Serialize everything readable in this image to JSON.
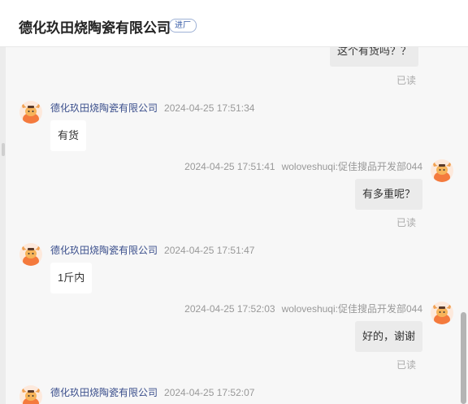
{
  "header": {
    "title": "德化玖田烧陶瓷有限公司",
    "tag": "进厂"
  },
  "read_label": "已读",
  "messages": [
    {
      "side": "out",
      "text": "这个有货吗？？",
      "read": "已读"
    },
    {
      "side": "in",
      "sender": "德化玖田烧陶瓷有限公司",
      "time": "2024-04-25 17:51:34",
      "text": "有货"
    },
    {
      "side": "out",
      "sender": "woloveshuqi:促佳搜品开发部044",
      "time": "2024-04-25 17:51:41",
      "text": "有多重呢？",
      "read": "已读"
    },
    {
      "side": "in",
      "sender": "德化玖田烧陶瓷有限公司",
      "time": "2024-04-25 17:51:47",
      "text": "1斤内"
    },
    {
      "side": "out",
      "sender": "woloveshuqi:促佳搜品开发部044",
      "time": "2024-04-25 17:52:03",
      "text": "好的，谢谢",
      "read": "已读"
    },
    {
      "side": "in",
      "sender": "德化玖田烧陶瓷有限公司",
      "time": "2024-04-25 17:52:07"
    }
  ],
  "avatar_icon": "cartoon-bull-avatar-icon",
  "colors": {
    "sender_name": "#3b4f8c",
    "outgoing_bubble": "#ebebeb",
    "incoming_bubble": "#ffffff",
    "avatar_orange": "#f47a3d"
  }
}
